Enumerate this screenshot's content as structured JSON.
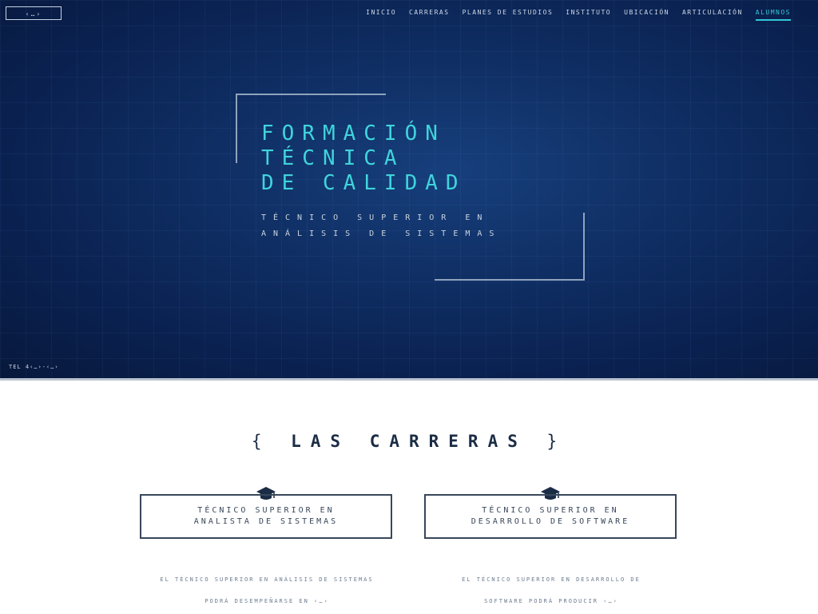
{
  "header": {
    "logo_text": "‹…›",
    "nav": [
      {
        "label": "INICIO"
      },
      {
        "label": "CARRERAS"
      },
      {
        "label": "PLANES DE ESTUDIOS"
      },
      {
        "label": "INSTITUTO"
      },
      {
        "label": "UBICACIÓN"
      },
      {
        "label": "ARTICULACIÓN"
      },
      {
        "label": "ALUMNOS",
        "active": true
      }
    ]
  },
  "hero": {
    "title_lines": [
      "FORMACIÓN",
      "TÉCNICA",
      "DE CALIDAD"
    ],
    "subtitle": "TÉCNICO SUPERIOR EN ANÁLISIS DE SISTEMAS",
    "phone": "TEL 4‹…›-‹…›"
  },
  "carreras": {
    "title": "LAS CARRERAS",
    "brace_open": "{",
    "brace_close": "}",
    "cards": [
      {
        "title": "TÉCNICO SUPERIOR EN ANALISTA DE SISTEMAS",
        "icon": "graduation-cap-icon",
        "description": "EL TÉCNICO SUPERIOR EN ANÁLISIS DE SISTEMAS PODRÁ DESEMPEÑARSE EN ‹…›"
      },
      {
        "title": "TÉCNICO SUPERIOR EN DESARROLLO DE SOFTWARE",
        "icon": "graduation-cap-icon",
        "description": "EL TÉCNICO SUPERIOR EN DESARROLLO DE SOFTWARE PODRÁ PRODUCIR ‹…›"
      }
    ]
  },
  "colors": {
    "accent": "#3fd4dc",
    "hero_bg": "#0f2e63",
    "ink": "#1b2c45"
  }
}
